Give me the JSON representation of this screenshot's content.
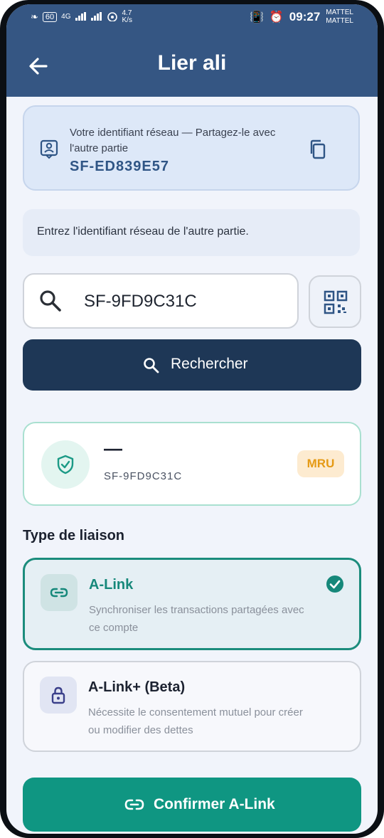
{
  "status_bar": {
    "left_badge": "60",
    "net1": "4G",
    "speed": "4.7",
    "speed_unit": "K/s",
    "time": "09:27",
    "carrier1": "MATTEL",
    "carrier2": "MATTEL"
  },
  "header": {
    "title": "Lier ali"
  },
  "network_id_card": {
    "description": "Votre identifiant réseau — Partagez-le avec l'autre partie",
    "id_value": "SF-ED839E57"
  },
  "hint": {
    "text": "Entrez l'identifiant réseau de l'autre partie."
  },
  "search": {
    "value": "SF-9FD9C31C",
    "button_label": "Rechercher"
  },
  "result": {
    "name": "—",
    "id": "SF-9FD9C31C",
    "currency_badge": "MRU"
  },
  "link_type": {
    "section_title": "Type de liaison",
    "options": [
      {
        "title": "A-Link",
        "description": "Synchroniser les transactions partagées avec ce compte",
        "selected": true
      },
      {
        "title": "A-Link+ (Beta)",
        "description": "Nécessite le consentement mutuel pour créer ou modifier des dettes",
        "selected": false
      }
    ]
  },
  "confirm_button": {
    "label": "Confirmer A-Link"
  },
  "colors": {
    "header_bg": "#355683",
    "primary_dark": "#1e3756",
    "accent_teal": "#0f9682",
    "badge_orange": "#e59a15"
  }
}
